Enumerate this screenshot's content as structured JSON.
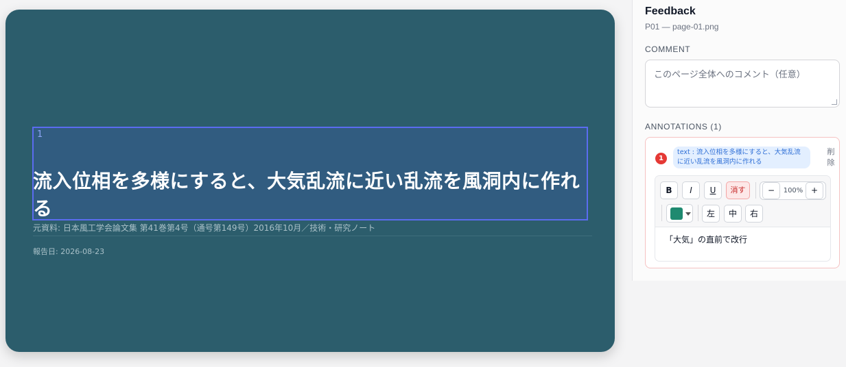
{
  "slide": {
    "selection_number": "1",
    "title": "流入位相を多様にすると、大気乱流に近い乱流を風洞内に作れる",
    "source": "元資料: 日本風工学会論文集 第41巻第4号（通号第149号）2016年10月／技術・研究ノート",
    "date": "報告日: 2026-08-23"
  },
  "panel": {
    "title": "Feedback",
    "subtitle": "P01 — page-01.png",
    "comment_label": "COMMENT",
    "comment_placeholder": "このページ全体へのコメント（任意）",
    "annotations_label": "ANNOTATIONS (1)",
    "annotation": {
      "number": "1",
      "chip_text": "text : 流入位相を多様にすると、大気乱流に近い乱流を風洞内に作れる",
      "delete_label": "削除",
      "toolbar": {
        "bold": "B",
        "italic": "I",
        "underline": "U",
        "strike": "消す",
        "zoom_minus": "−",
        "zoom_value": "100%",
        "zoom_plus": "+",
        "color": "#1f8a70",
        "align_left": "左",
        "align_center": "中",
        "align_right": "右"
      },
      "body_text": "「大気」の直前で改行"
    }
  },
  "colors": {
    "slide_bg": "#2c5d6c",
    "selection_border": "#5b6cf0",
    "badge": "#e53935",
    "chip_bg": "#e3efff"
  }
}
